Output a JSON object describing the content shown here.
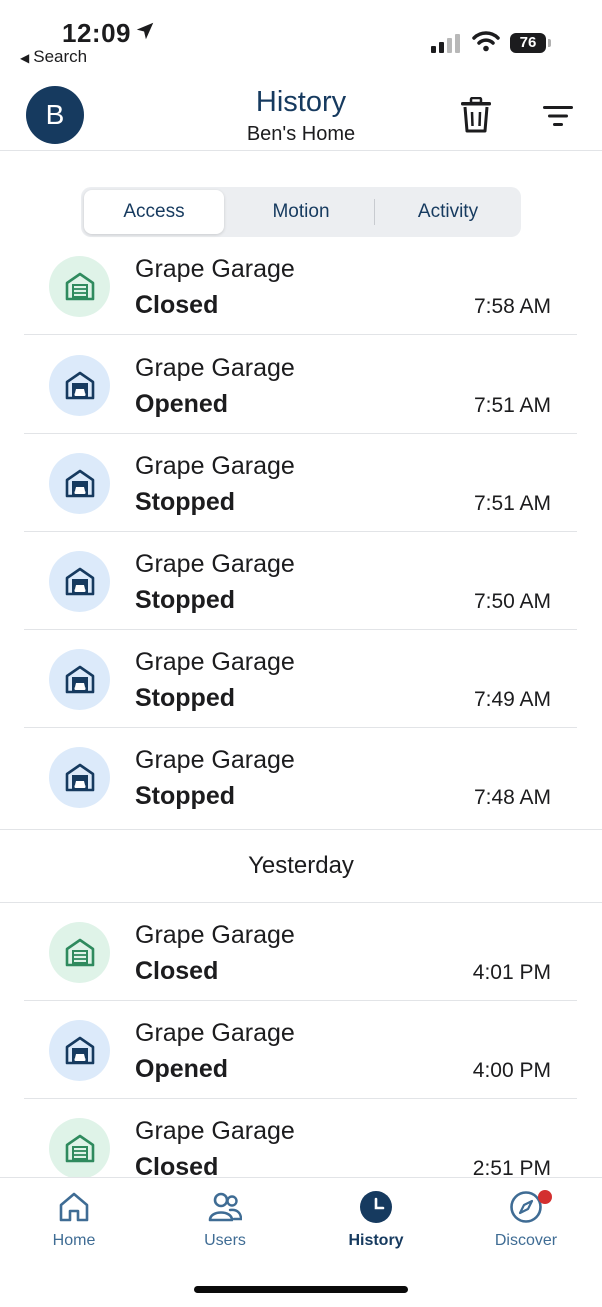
{
  "status_bar": {
    "time": "12:09",
    "back_label": "Search",
    "battery": "76"
  },
  "header": {
    "avatar_letter": "B",
    "title": "History",
    "subtitle": "Ben's Home"
  },
  "segments": [
    {
      "label": "Access",
      "active": true
    },
    {
      "label": "Motion",
      "active": false
    },
    {
      "label": "Activity",
      "active": false
    }
  ],
  "today_events": [
    {
      "device": "Grape Garage",
      "state": "Closed",
      "time": "7:58 AM",
      "icon": "garage-closed-icon"
    },
    {
      "device": "Grape Garage",
      "state": "Opened",
      "time": "7:51 AM",
      "icon": "garage-open-car-icon"
    },
    {
      "device": "Grape Garage",
      "state": "Stopped",
      "time": "7:51 AM",
      "icon": "garage-open-car-icon"
    },
    {
      "device": "Grape Garage",
      "state": "Stopped",
      "time": "7:50 AM",
      "icon": "garage-open-car-icon"
    },
    {
      "device": "Grape Garage",
      "state": "Stopped",
      "time": "7:49 AM",
      "icon": "garage-open-car-icon"
    },
    {
      "device": "Grape Garage",
      "state": "Stopped",
      "time": "7:48 AM",
      "icon": "garage-open-car-icon"
    }
  ],
  "yesterday": {
    "header": "Yesterday",
    "events": [
      {
        "device": "Grape Garage",
        "state": "Closed",
        "time": "4:01 PM",
        "icon": "garage-closed-icon"
      },
      {
        "device": "Grape Garage",
        "state": "Opened",
        "time": "4:00 PM",
        "icon": "garage-open-car-icon"
      },
      {
        "device": "Grape Garage",
        "state": "Closed",
        "time": "2:51 PM",
        "icon": "garage-closed-icon"
      }
    ]
  },
  "tabs": [
    {
      "label": "Home",
      "icon": "house-icon",
      "active": false
    },
    {
      "label": "Users",
      "icon": "users-icon",
      "active": false
    },
    {
      "label": "History",
      "icon": "clock-icon",
      "active": true
    },
    {
      "label": "Discover",
      "icon": "compass-icon",
      "active": false,
      "badge": true
    }
  ],
  "colors": {
    "brand": "#163a5f",
    "closed_bg": "#dff3e8",
    "closed_icon": "#2f8a5e",
    "opened_bg": "#dceafa",
    "badge": "#d32f2f"
  }
}
